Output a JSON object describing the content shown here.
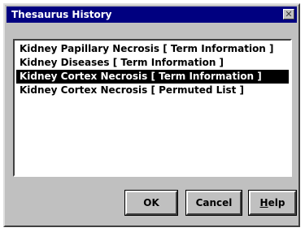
{
  "window": {
    "title": "Thesaurus History",
    "close_glyph": "✕"
  },
  "history_list": {
    "items": [
      {
        "label": "Kidney Papillary Necrosis [ Term Information ]",
        "selected": false
      },
      {
        "label": "Kidney Diseases [ Term Information ]",
        "selected": false
      },
      {
        "label": "Kidney Cortex Necrosis [ Term Information ]",
        "selected": true
      },
      {
        "label": "Kidney Cortex Necrosis [ Permuted List ]",
        "selected": false
      }
    ]
  },
  "buttons": {
    "ok_label": "OK",
    "cancel_label": "Cancel",
    "help_label": "Help"
  },
  "colors": {
    "titlebar": "#000080",
    "dialog_face": "#c0c0c0",
    "selection": "#000000"
  }
}
